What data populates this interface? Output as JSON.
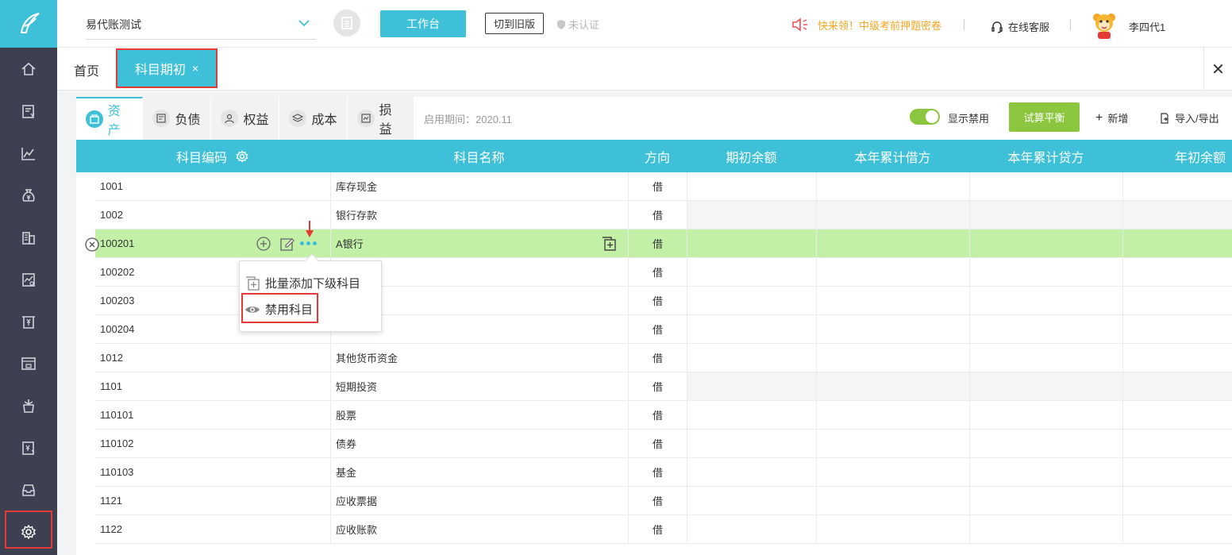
{
  "header": {
    "company": "易代账测试",
    "workbench_label": "工作台",
    "switch_old_label": "切到旧版",
    "uncertified_label": "未认证",
    "promo_text": "快来领！中级考前押题密卷",
    "service_label": "在线客服",
    "username": "李四代1"
  },
  "tabs": {
    "home": "首页",
    "active": "科目期初",
    "close_char": "×"
  },
  "panel_close": "✕",
  "subtabs": [
    {
      "label": "资产",
      "icon": "assets-icon"
    },
    {
      "label": "负债",
      "icon": "liability-icon"
    },
    {
      "label": "权益",
      "icon": "equity-icon"
    },
    {
      "label": "成本",
      "icon": "cost-icon"
    },
    {
      "label": "损益",
      "icon": "pnl-icon"
    }
  ],
  "period_label": "启用期间：2020.11",
  "toolbar": {
    "show_disabled_label": "显示禁用",
    "show_disabled_on": true,
    "trial_balance_label": "试算平衡",
    "add_label": "新增",
    "import_export_label": "导入/导出"
  },
  "table": {
    "columns": [
      "科目编码",
      "科目名称",
      "方向",
      "期初余额",
      "本年累计借方",
      "本年累计贷方",
      "年初余额"
    ],
    "rows": [
      {
        "code": "1001",
        "name": "库存现金",
        "dir": "借"
      },
      {
        "code": "1002",
        "name": "银行存款",
        "dir": "借"
      },
      {
        "code": "100201",
        "name": "A银行",
        "dir": "借"
      },
      {
        "code": "100202",
        "name": "",
        "dir": "借"
      },
      {
        "code": "100203",
        "name": "",
        "dir": "借"
      },
      {
        "code": "100204",
        "name": "",
        "dir": "借"
      },
      {
        "code": "1012",
        "name": "其他货币资金",
        "dir": "借"
      },
      {
        "code": "1101",
        "name": "短期投资",
        "dir": "借"
      },
      {
        "code": "110101",
        "name": "股票",
        "dir": "借"
      },
      {
        "code": "110102",
        "name": "债券",
        "dir": "借"
      },
      {
        "code": "110103",
        "name": "基金",
        "dir": "借"
      },
      {
        "code": "1121",
        "name": "应收票据",
        "dir": "借"
      },
      {
        "code": "1122",
        "name": "应收账款",
        "dir": "借"
      }
    ]
  },
  "popup": {
    "batch_add_label": "批量添加下级科目",
    "disable_label": "禁用科目"
  },
  "colors": {
    "accent": "#3ec0d9",
    "sidebar": "#3d4050",
    "green": "#8cc63f",
    "selected_row": "#c3f0a7",
    "highlight": "#e53935"
  }
}
